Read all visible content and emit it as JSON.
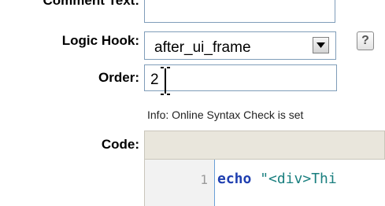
{
  "form": {
    "comment_label": "Comment Text:",
    "logic_hook_label": "Logic Hook:",
    "logic_hook_value": "after_ui_frame",
    "help_glyph": "?",
    "order_label": "Order:",
    "order_value": "2",
    "info_text": "Info: Online Syntax Check is set",
    "code_label": "Code:"
  },
  "editor": {
    "line_number": "1",
    "code_keyword": "echo",
    "code_string": " \"<div>Thi"
  },
  "colors": {
    "field_border": "#7f9db9",
    "toolbar_bg": "#e9e6dc",
    "gutter_border": "#6aa0d8",
    "keyword": "#1f3fb0",
    "string": "#1a7f7f"
  },
  "icons": [
    "chevron-down-icon",
    "help-icon",
    "text-cursor-icon"
  ]
}
